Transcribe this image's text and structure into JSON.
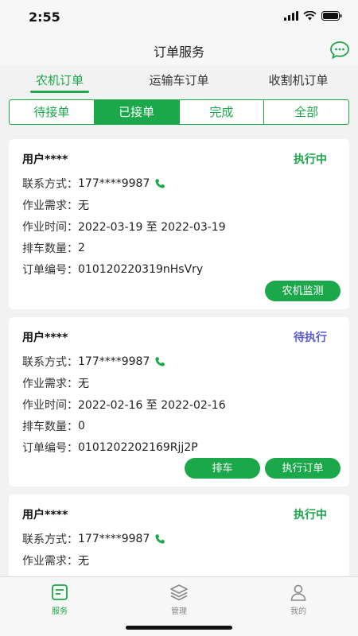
{
  "status_bar": {
    "time": "2:55"
  },
  "header": {
    "title": "订单服务"
  },
  "type_tabs": [
    {
      "label": "农机订单",
      "active": true
    },
    {
      "label": "运输车订单",
      "active": false
    },
    {
      "label": "收割机订单",
      "active": false
    }
  ],
  "status_tabs": [
    {
      "label": "待接单",
      "active": false
    },
    {
      "label": "已接单",
      "active": true
    },
    {
      "label": "完成",
      "active": false
    },
    {
      "label": "全部",
      "active": false
    }
  ],
  "labels": {
    "contact": "联系方式：",
    "demand": "作业需求：",
    "time": "作业时间：",
    "count": "排车数量：",
    "order_no": "订单编号："
  },
  "orders": [
    {
      "user": "用户****",
      "state": "执行中",
      "phone": "177****9987",
      "demand": "无",
      "time": "2022-03-19 至 2022-03-19",
      "count": "2",
      "order_no": "010120220319nHsVry",
      "buttons": [
        "农机监测"
      ]
    },
    {
      "user": "用户****",
      "state": "待执行",
      "phone": "177****9987",
      "demand": "无",
      "time": "2022-02-16 至 2022-02-16",
      "count": "0",
      "order_no": "0101202202169Rjj2P",
      "buttons": [
        "排车",
        "执行订单"
      ]
    },
    {
      "user": "用户****",
      "state": "执行中",
      "phone": "177****9987",
      "demand": "无"
    }
  ],
  "tabbar": [
    {
      "label": "服务",
      "icon": "service-icon",
      "active": true
    },
    {
      "label": "管理",
      "icon": "layers-icon",
      "active": false
    },
    {
      "label": "我的",
      "icon": "person-icon",
      "active": false
    }
  ],
  "colors": {
    "accent": "#1ba84a",
    "pending": "#5b5bd6"
  }
}
